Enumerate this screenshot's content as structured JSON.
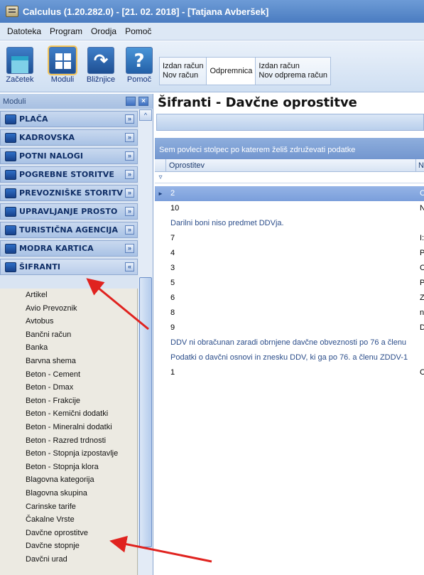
{
  "window": {
    "title": "Calculus (1.20.282.0) - [21. 02. 2018] - [Tatjana Avberšek]"
  },
  "menu": {
    "items": [
      "Datoteka",
      "Program",
      "Orodja",
      "Pomoč"
    ]
  },
  "ribbon": {
    "buttons": [
      {
        "label": "Začetek",
        "icon": "home-icon"
      },
      {
        "label": "Moduli",
        "icon": "modules-icon"
      },
      {
        "label": "Bližnjice",
        "icon": "shortcut-icon"
      },
      {
        "label": "Pomoč",
        "icon": "help-icon"
      }
    ],
    "quick_tabs": [
      {
        "line1": "Izdan račun",
        "line2": "Nov račun"
      },
      {
        "line1": "Odpremnica",
        "line2": ""
      },
      {
        "line1": "Izdan račun",
        "line2": "Nov odprema račun"
      }
    ]
  },
  "sidebar": {
    "header": "Moduli",
    "groups": [
      "PLAČA",
      "KADROVSKA",
      "POTNI NALOGI",
      "POGREBNE STORITVE",
      "PREVOZNIŠKE STORITV",
      "UPRAVLJANJE PROSTO",
      "TURISTIČNA AGENCIJA",
      "MODRA KARTICA",
      "ŠIFRANTI"
    ],
    "items": [
      "Artikel",
      "Avio Prevoznik",
      "Avtobus",
      "Bančni račun",
      "Banka",
      "Barvna shema",
      "Beton - Cement",
      "Beton - Dmax",
      "Beton - Frakcije",
      "Beton - Kemični dodatki",
      "Beton - Mineralni dodatki",
      "Beton - Razred trdnosti",
      "Beton - Stopnja izpostavlje",
      "Beton - Stopnja klora",
      "Blagovna kategorija",
      "Blagovna skupina",
      "Carinske tarife",
      "Čakalne Vrste",
      "Davčne oprostitve",
      "Davčne stopnje",
      "Davčni urad"
    ]
  },
  "main": {
    "title": "Šifranti - Davčne oprostitve",
    "group_hint": "Sem povleci stolpec po katerem želiš združevati podatke",
    "columns": [
      "Oprostitev",
      "N"
    ],
    "rows": [
      {
        "code": "2",
        "c2": "C"
      },
      {
        "code": "10",
        "c2": "N"
      },
      {
        "preview": "Darilni boni niso predmet DDVja."
      },
      {
        "code": "7",
        "c2": "I:"
      },
      {
        "code": "4",
        "c2": "P"
      },
      {
        "code": "3",
        "c2": "C"
      },
      {
        "code": "5",
        "c2": "P"
      },
      {
        "code": "6",
        "c2": "Z"
      },
      {
        "code": "8",
        "c2": "n"
      },
      {
        "code": "9",
        "c2": "D"
      },
      {
        "preview": "DDV ni obračunan zaradi obrnjene davčne obveznosti po 76 a členu"
      },
      {
        "preview": "Podatki o davčni osnovi in znesku DDV, ki ga po 76. a členu ZDDV-1"
      },
      {
        "code": "1",
        "c2": "C"
      }
    ]
  },
  "colors": {
    "accent": "#4a7cc1",
    "selection": "#7a9edb",
    "annotation_arrow": "#e0231f"
  }
}
